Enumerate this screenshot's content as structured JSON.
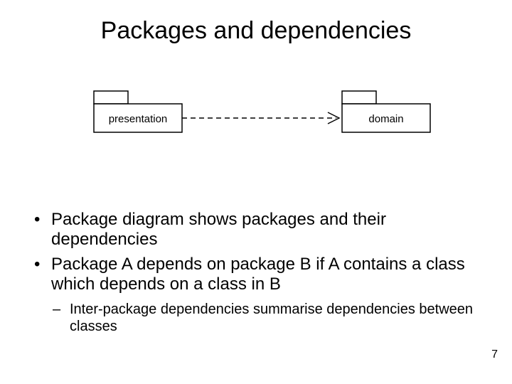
{
  "title": "Packages and dependencies",
  "diagram": {
    "package_left": "presentation",
    "package_right": "domain"
  },
  "bullets": {
    "items": [
      "Package diagram shows packages and their dependencies",
      "Package A depends on package B if A contains a class which depends on a class in B"
    ],
    "sub": "Inter-package dependencies summarise dependencies between classes"
  },
  "page_number": "7"
}
